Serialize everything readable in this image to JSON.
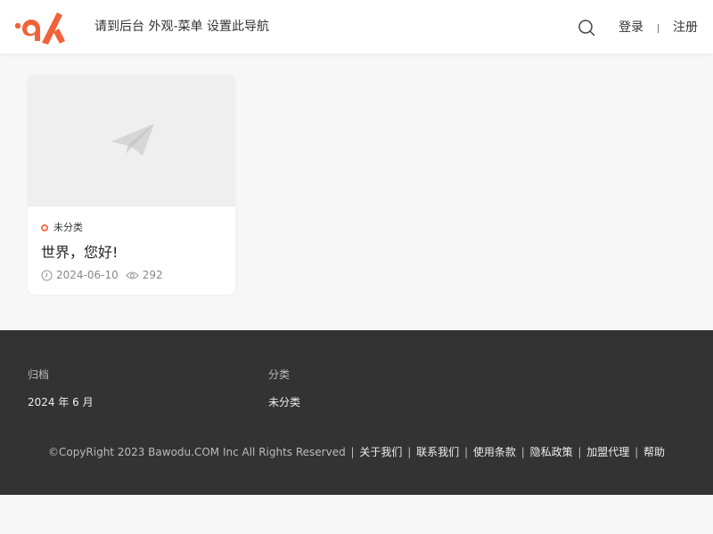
{
  "header": {
    "logo_icon": "brand-logo-icon",
    "nav_hint": "请到后台 外观-菜单 设置此导航",
    "search_icon": "search-icon",
    "login_label": "登录",
    "register_label": "注册",
    "accent_color": "#f0623a"
  },
  "post": {
    "thumb_icon": "paper-plane-icon",
    "category": "未分类",
    "title": "世界，您好!",
    "date": "2024-06-10",
    "views": "292"
  },
  "footer": {
    "columns": [
      {
        "title": "归档",
        "item": "2024 年 6 月"
      },
      {
        "title": "分类",
        "item": "未分类"
      }
    ],
    "copyright": "©CopyRight 2023 Bawodu.COM Inc All Rights Reserved",
    "links": [
      "关于我们",
      "联系我们",
      "使用条款",
      "隐私政策",
      "加盟代理",
      "帮助"
    ],
    "background": "#333333"
  }
}
